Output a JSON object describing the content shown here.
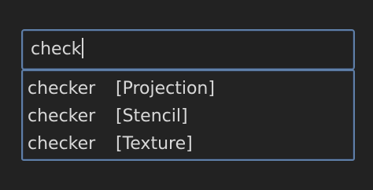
{
  "search": {
    "value": "check"
  },
  "results": [
    {
      "name": "checker",
      "category": "[Projection]"
    },
    {
      "name": "checker",
      "category": "[Stencil]"
    },
    {
      "name": "checker",
      "category": "[Texture]"
    }
  ],
  "colors": {
    "background": "#222222",
    "field_border": "#5f7fa8",
    "text": "#d8d8d8"
  }
}
